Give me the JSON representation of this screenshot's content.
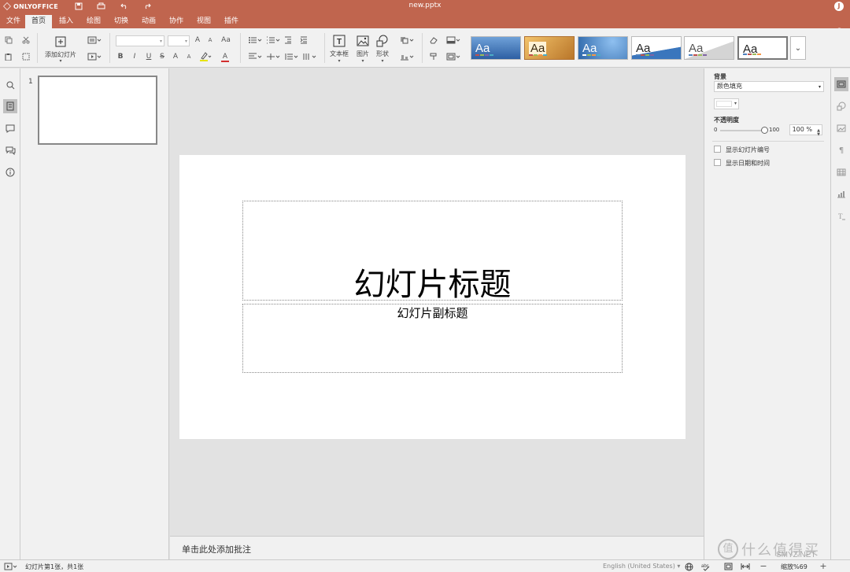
{
  "app": {
    "logo_text": "ONLYOFFICE",
    "doc_title": "new.pptx",
    "user_initial": "J"
  },
  "menu": {
    "tabs": [
      "文件",
      "首页",
      "插入",
      "绘图",
      "切换",
      "动画",
      "协作",
      "视图",
      "插件"
    ],
    "active_index": 1
  },
  "toolbar": {
    "add_slide_label": "添加幻灯片",
    "textbox_label": "文本框",
    "image_label": "图片",
    "shape_label": "形状",
    "font_size_up": "A",
    "font_size_down": "A",
    "change_case": "Aa",
    "bold": "B",
    "italic": "I",
    "underline": "U",
    "strike": "S",
    "superscript": "A",
    "subscript": "A",
    "font_color": "A",
    "themes": [
      {
        "label": "Aa",
        "bg": "#3f75b8",
        "fg": "#ffffff"
      },
      {
        "label": "Aa",
        "bg": "#d7a245",
        "fg": "#3a2a10"
      },
      {
        "label": "Aa",
        "bg": "#2f6fb5",
        "fg": "#ffffff"
      },
      {
        "label": "Aa",
        "bg": "#ffffff",
        "fg": "#222222"
      },
      {
        "label": "Aa",
        "bg": "#e8e8e8",
        "fg": "#555555"
      },
      {
        "label": "Aa",
        "bg": "#ffffff",
        "fg": "#222222"
      }
    ]
  },
  "thumbs": {
    "items": [
      {
        "number": "1"
      }
    ]
  },
  "slide": {
    "title": "幻灯片标题",
    "subtitle": "幻灯片副标题"
  },
  "notes": {
    "placeholder": "单击此处添加批注"
  },
  "right_panel": {
    "background_label": "背景",
    "fill_type": "颜色填充",
    "opacity_label": "不透明度",
    "opacity_min": "0",
    "opacity_max": "100",
    "opacity_value": "100 %",
    "opacity_fraction": 1.0,
    "show_slide_number": "显示幻灯片编号",
    "show_date_time": "显示日期和时间"
  },
  "status": {
    "slide_info": "幻灯片第1张，共1张",
    "language": "English (United States)",
    "zoom": "缩放%69"
  },
  "watermark": {
    "circle": "值",
    "text": "什么值得买",
    "site": "SMYZ.NET"
  },
  "colors": {
    "accent": "#c0654e",
    "panel": "#f1f1f1",
    "canvas": "#e2e2e2"
  }
}
